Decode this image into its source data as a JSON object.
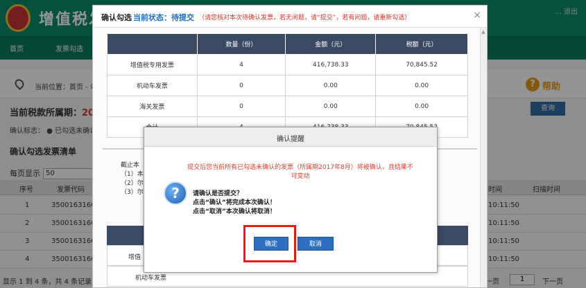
{
  "colors": {
    "accent": "#0d8a6c",
    "primary_button": "#2f6fbf",
    "warning": "#e23b2e",
    "highlight": "#e31b1b",
    "table_header": "#3b4a63"
  },
  "background": {
    "site_title": "增值税发",
    "header_right": "…  退出",
    "nav": [
      "首页",
      "发票勾选"
    ],
    "breadcrumb": "当前位置：首页 - 勾",
    "help_label": "帮助",
    "period_label": "当前税款所属期：",
    "period_year": "2017",
    "query_label": "查询",
    "confirm_flag": "确认标志：  ● 已勾选未确认",
    "section_title": "确认勾选发票清单",
    "page_size_label": "每页显示",
    "page_size_value": "50",
    "list_headers": [
      "序号",
      "发票代码",
      "时间",
      "扫描时间"
    ],
    "rows": [
      {
        "no": "1",
        "code": "3500163160",
        "time": "10:11:50"
      },
      {
        "no": "2",
        "code": "3500163160",
        "time": "10:11:50"
      },
      {
        "no": "3",
        "code": "3500163160",
        "time": "10:11:50"
      },
      {
        "no": "4",
        "code": "3500163160",
        "time": "10:11:50"
      }
    ],
    "pager_summary": "显示 1 到 4 条，共 4 条记录",
    "pager_prev": "一页",
    "pager_page": "1",
    "pager_next": "下一页"
  },
  "modal": {
    "title": "确认勾选",
    "status": "当前状态：待提交",
    "note": "（请您核对本次待确认发票，若无问题，请“提交”，若有问题，请重新勾选）",
    "close": "×",
    "table_headers": [
      "",
      "数量（份）",
      "金额（元）",
      "税额（元）"
    ],
    "table_rows": [
      [
        "增值税专用发票",
        "4",
        "416,738.33",
        "70,845.52"
      ],
      [
        "机动车发票",
        "0",
        "0.00",
        "0.00"
      ],
      [
        "海关发票",
        "0",
        "0.00",
        "0.00"
      ],
      [
        "合计",
        "4",
        "416,738.33",
        "70,845.52"
      ]
    ],
    "notes_1": "截止本",
    "notes_2": "（1）本",
    "notes_3": "（2）尔",
    "notes_4": "（3）尔",
    "row2_label": "增值",
    "row3_label": "机动车发票"
  },
  "confirm": {
    "title": "确认提醒",
    "warning": "提交后您当前所有已勾选未确认的发票（所属期2017年8月）将被确认，且结果不可变动",
    "icon_glyph": "?",
    "msg_line1": "请确认是否提交？",
    "msg_line2": "点击“确认”将完成本次确认！",
    "msg_line3": "点击“取消”本次确认将取消！",
    "ok_label": "确定",
    "cancel_label": "取消"
  }
}
